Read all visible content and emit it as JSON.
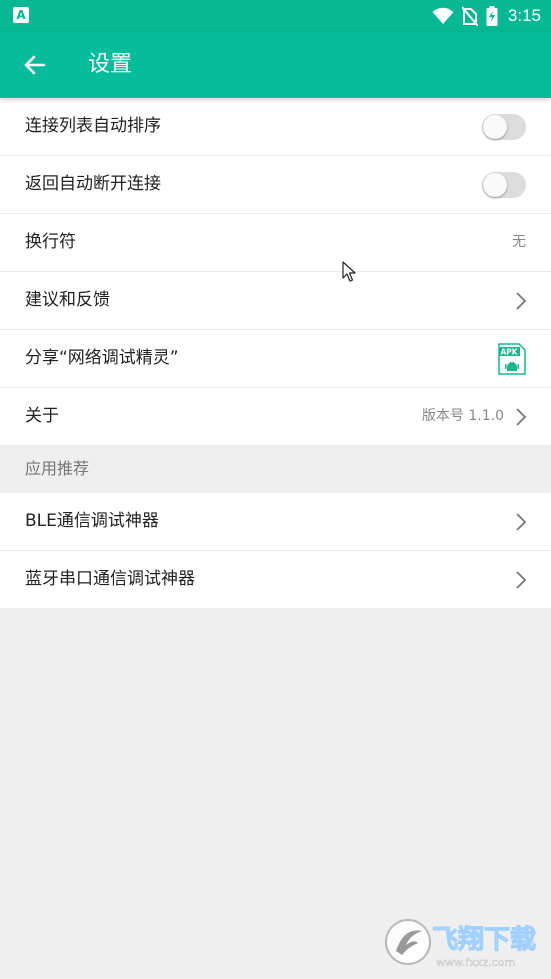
{
  "status_bar": {
    "time": "3:15",
    "app_icon": "app-a-icon",
    "icons": [
      "wifi-icon",
      "no-sim-icon",
      "battery-charging-icon"
    ]
  },
  "toolbar": {
    "back_icon": "arrow-back-icon",
    "title": "设置"
  },
  "settings": [
    {
      "label": "连接列表自动排序",
      "control": "toggle",
      "checked": false
    },
    {
      "label": "返回自动断开连接",
      "control": "toggle",
      "checked": false
    },
    {
      "label": "换行符",
      "value": "无"
    },
    {
      "label": "建议和反馈",
      "control": "chevron"
    },
    {
      "label": "分享“网络调试精灵”",
      "icon": "apk-file-icon",
      "icon_text": "APK"
    },
    {
      "label": "关于",
      "value": "版本号 1.1.0",
      "control": "chevron"
    }
  ],
  "recommend_section": {
    "title": "应用推荐",
    "items": [
      {
        "label": "BLE通信调试神器"
      },
      {
        "label": "蓝牙串口通信调试神器"
      }
    ]
  },
  "watermark": {
    "text": "飞翔下载",
    "subtext": "www.fxxz.com"
  },
  "colors": {
    "primary": "#06bc9b",
    "status_bar": "#06b894",
    "background": "#efefef",
    "toggle_off_track": "#dcdcdc"
  }
}
